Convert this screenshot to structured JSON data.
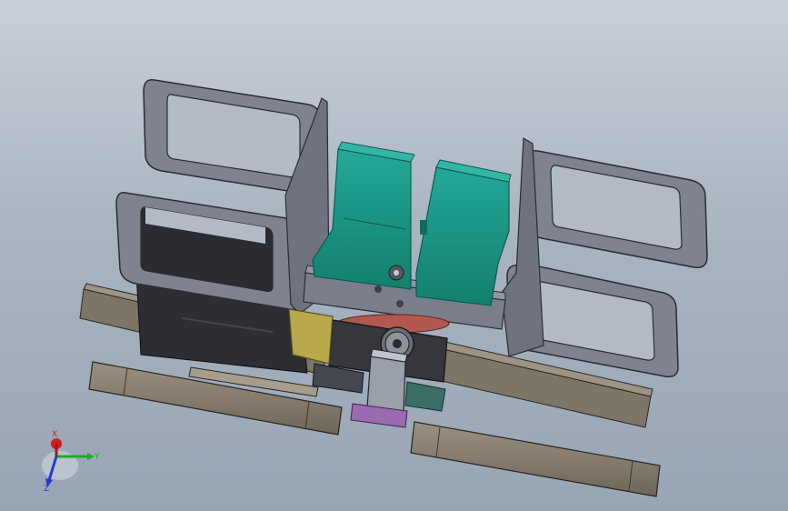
{
  "viewport": {
    "background_top": "#c8cfd8",
    "background_bottom": "#98a5b4"
  },
  "colors": {
    "frame_gray": "#7f8390",
    "frame_dark": "#5e6270",
    "rail_tan": "#8c8273",
    "rail_dark": "#5b5347",
    "motor_teal": "#1e9a8c",
    "motor_teal_dark": "#157268",
    "yellow_part": "#b8a94a",
    "purple_part": "#9a6bb0",
    "red_disc": "#b2594f"
  },
  "triad": {
    "x_label": "X",
    "y_label": "Y",
    "z_label": "Z",
    "x_color": "#d21e1e",
    "y_color": "#1fa82a",
    "z_color": "#1f3fd0"
  }
}
